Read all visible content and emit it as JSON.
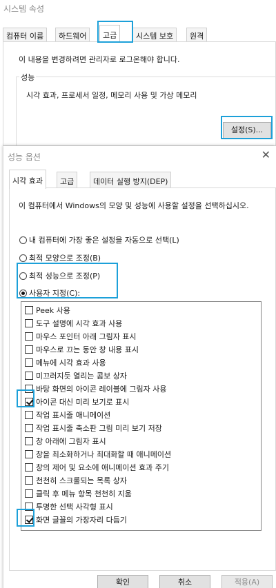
{
  "system_properties": {
    "title": "시스템 속성",
    "tabs": [
      "컴퓨터 이름",
      "하드웨어",
      "고급",
      "시스템 보호",
      "원격"
    ],
    "active_tab": "고급",
    "admin_message": "이 내용을 변경하려면 관리자로 로그온해야 합니다.",
    "performance": {
      "legend": "성능",
      "description": "시각 효과, 프로세서 일정, 메모리 사용 및 가상 메모리",
      "settings_button": "설정(S)..."
    }
  },
  "performance_options": {
    "title": "성능 옵션",
    "close_glyph": "✕",
    "tabs": [
      "시각 효과",
      "고급",
      "데이터 실행 방지(DEP)"
    ],
    "active_tab": "시각 효과",
    "intro": "이 컴퓨터에서 Windows의 모양 및 성능에 사용할 설정을 선택하십시오.",
    "radios": [
      {
        "label": "내 컴퓨터에 가장 좋은 설정을 자동으로 선택(L)",
        "selected": false
      },
      {
        "label": "최적 모양으로 조정(B)",
        "selected": false
      },
      {
        "label": "최적 성능으로 조정(P)",
        "selected": false
      },
      {
        "label": "사용자 지정(C):",
        "selected": true
      }
    ],
    "effects": [
      {
        "label": "Peek 사용",
        "checked": false
      },
      {
        "label": "도구 설명에 시각 효과 사용",
        "checked": false
      },
      {
        "label": "마우스 포인터 아래 그림자 표시",
        "checked": false
      },
      {
        "label": "마우스로 끄는 동안 창 내용 표시",
        "checked": false
      },
      {
        "label": "메뉴에 시각 효과 사용",
        "checked": false
      },
      {
        "label": "미끄러지듯 열리는 콤보 상자",
        "checked": false
      },
      {
        "label": "바탕 화면의 아이콘 레이블에 그림자 사용",
        "checked": false
      },
      {
        "label": "아이콘 대신 미리 보기로 표시",
        "checked": true
      },
      {
        "label": "작업 표시줄 애니메이션",
        "checked": false
      },
      {
        "label": "작업 표시줄 축소판 그림 미리 보기 저장",
        "checked": false
      },
      {
        "label": "창 아래에 그림자 표시",
        "checked": false
      },
      {
        "label": "창을 최소화하거나 최대화할 때 애니메이션",
        "checked": false
      },
      {
        "label": "창의 제어 및 요소에 애니메이션 효과 주기",
        "checked": false
      },
      {
        "label": "천천히 스크롤되는 목록 상자",
        "checked": false
      },
      {
        "label": "클릭 후 메뉴 항목 천천히 지움",
        "checked": false
      },
      {
        "label": "투명한 선택 사각형 표시",
        "checked": false
      },
      {
        "label": "화면 글꼴의 가장자리 다듬기",
        "checked": true
      }
    ],
    "buttons": {
      "ok": "확인",
      "cancel": "취소",
      "apply": "적용(A)"
    }
  },
  "colors": {
    "highlight": "#1ca0d9"
  }
}
